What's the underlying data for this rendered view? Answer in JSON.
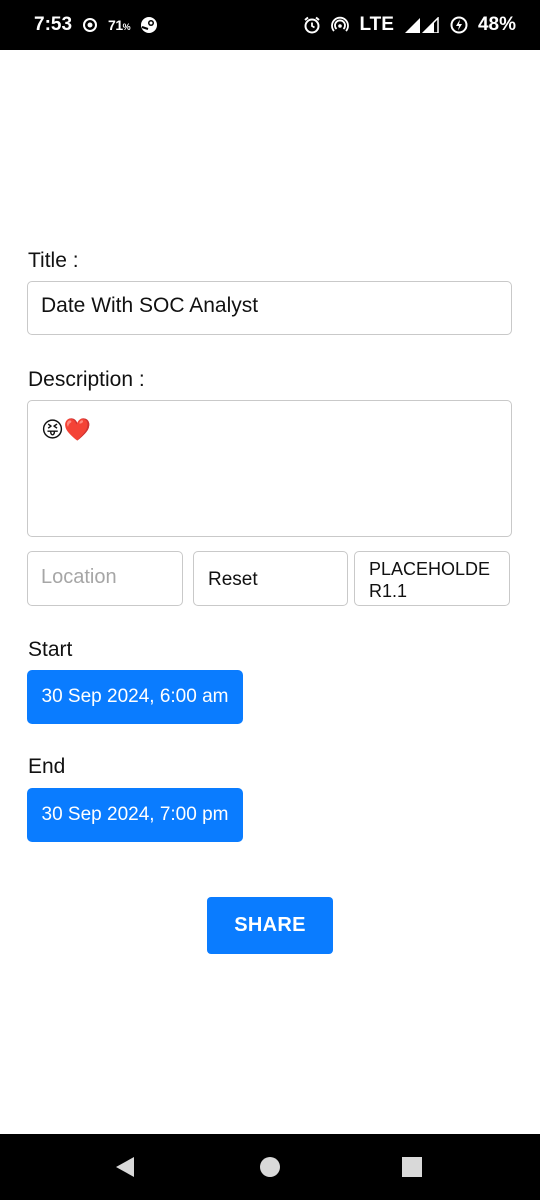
{
  "status_bar": {
    "time": "7:53",
    "temp": "71",
    "temp_unit": "%",
    "network": "LTE",
    "battery": "48%"
  },
  "form": {
    "title_label": "Title :",
    "title_value": "Date With SOC Analyst",
    "description_label": "Description :",
    "description_value": "😝❤️",
    "location_placeholder": "Location",
    "reset_label": "Reset",
    "placeholder_button": "PLACEHOLDER1.1",
    "start_label": "Start",
    "start_value": "30 Sep 2024, 6:00 am",
    "end_label": "End",
    "end_value": "30 Sep 2024, 7:00 pm",
    "share_label": "SHARE"
  },
  "colors": {
    "accent": "#0a7cff",
    "border": "#c9c9c9"
  }
}
